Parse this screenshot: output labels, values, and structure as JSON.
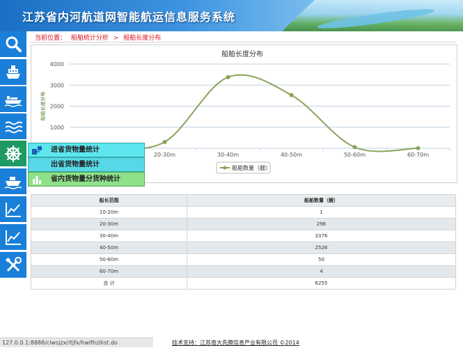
{
  "header": {
    "title": "江苏省内河航道网智能航运信息服务系统"
  },
  "breadcrumb": {
    "label": "当前位置：",
    "level1": "船舶统计分析",
    "sep": ">",
    "level2": "船舶长度分布"
  },
  "sidebar": {
    "items": [
      {
        "icon": "search-icon"
      },
      {
        "icon": "ship-front-icon"
      },
      {
        "icon": "cargo-ship-icon"
      },
      {
        "icon": "waves-icon"
      },
      {
        "icon": "helm-wheel-icon",
        "active": true
      },
      {
        "icon": "ship-icon"
      },
      {
        "icon": "line-chart-icon"
      },
      {
        "icon": "line-chart-icon"
      },
      {
        "icon": "tools-icon"
      }
    ]
  },
  "popup_menu": {
    "items": [
      {
        "label": "进省货物量统计"
      },
      {
        "label": "出省货物量统计"
      },
      {
        "label": "省内货物量分货种统计"
      }
    ]
  },
  "chart_data": {
    "type": "line",
    "title": "船舶长度分布",
    "ylabel": "船舶长度分布",
    "xlabel": "",
    "categories": [
      "10-20m",
      "20-30m",
      "30-40m",
      "40-50m",
      "50-60m",
      "60-70m"
    ],
    "series": [
      {
        "name": "船舶数量（艘）",
        "values": [
          1,
          298,
          3376,
          2526,
          50,
          4
        ]
      }
    ],
    "ylim": [
      0,
      4000
    ],
    "yticks": [
      1000,
      2000,
      3000,
      4000
    ],
    "grid": true,
    "legend": "bottom-center",
    "color": "#8aa35a"
  },
  "table": {
    "headers": [
      "船长范围",
      "船舶数量（艘）"
    ],
    "rows": [
      [
        "10-20m",
        "1"
      ],
      [
        "20-30m",
        "298"
      ],
      [
        "30-40m",
        "3376"
      ],
      [
        "40-50m",
        "2526"
      ],
      [
        "50-60m",
        "50"
      ],
      [
        "60-70m",
        "4"
      ],
      [
        "合 计",
        "6255"
      ]
    ]
  },
  "status_bar": {
    "url": "127.0.0.1:8888/clwsjzx//tjfx/hwlfhzllist.do"
  },
  "footer": {
    "text": "技术支持：江苏南大先腾信息产业有限公司 ©2014"
  }
}
